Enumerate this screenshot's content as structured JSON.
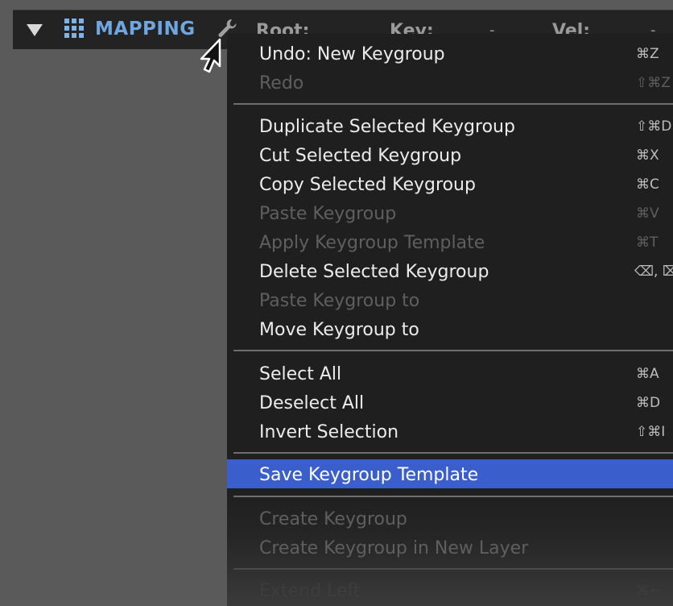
{
  "header": {
    "title": "MAPPING",
    "root_label": "Root:",
    "key_label": "Key:",
    "key_value": "-",
    "vel_label": "Vel:",
    "vel_value": "-"
  },
  "icons": {
    "collapse": "triangle-down-icon",
    "grid": "grid-icon",
    "wrench": "wrench-icon",
    "cursor": "arrow-cursor-icon"
  },
  "colors": {
    "accent": "#6fa6e0",
    "highlight": "#3a5fcd",
    "menu_bg": "#1f1f1f",
    "disabled_text": "#5f5f5f"
  },
  "menu": {
    "items": [
      {
        "label": "Undo: New Keygroup",
        "shortcut": "⌘Z",
        "enabled": true
      },
      {
        "label": "Redo",
        "shortcut": "⇧⌘Z",
        "enabled": false
      },
      {
        "label": "Duplicate Selected Keygroup",
        "shortcut": "⇧⌘D",
        "enabled": true
      },
      {
        "label": "Cut Selected Keygroup",
        "shortcut": "⌘X",
        "enabled": true
      },
      {
        "label": "Copy Selected Keygroup",
        "shortcut": "⌘C",
        "enabled": true
      },
      {
        "label": "Paste Keygroup",
        "shortcut": "⌘V",
        "enabled": false
      },
      {
        "label": "Apply Keygroup Template",
        "shortcut": "⌘T",
        "enabled": false
      },
      {
        "label": "Delete Selected Keygroup",
        "shortcut": "⌫, ⌦",
        "enabled": true
      },
      {
        "label": "Paste Keygroup to",
        "shortcut": "",
        "enabled": false
      },
      {
        "label": "Move Keygroup to",
        "shortcut": "",
        "enabled": true
      },
      {
        "label": "Select All",
        "shortcut": "⌘A",
        "enabled": true
      },
      {
        "label": "Deselect All",
        "shortcut": "⌘D",
        "enabled": true
      },
      {
        "label": "Invert Selection",
        "shortcut": "⇧⌘I",
        "enabled": true
      },
      {
        "label": "Save Keygroup Template",
        "shortcut": "",
        "enabled": true,
        "highlighted": true
      },
      {
        "label": "Create Keygroup",
        "shortcut": "",
        "enabled": false
      },
      {
        "label": "Create Keygroup in New Layer",
        "shortcut": "",
        "enabled": false
      },
      {
        "label": "Extend Left",
        "shortcut": "⌘←",
        "enabled": false
      }
    ]
  }
}
